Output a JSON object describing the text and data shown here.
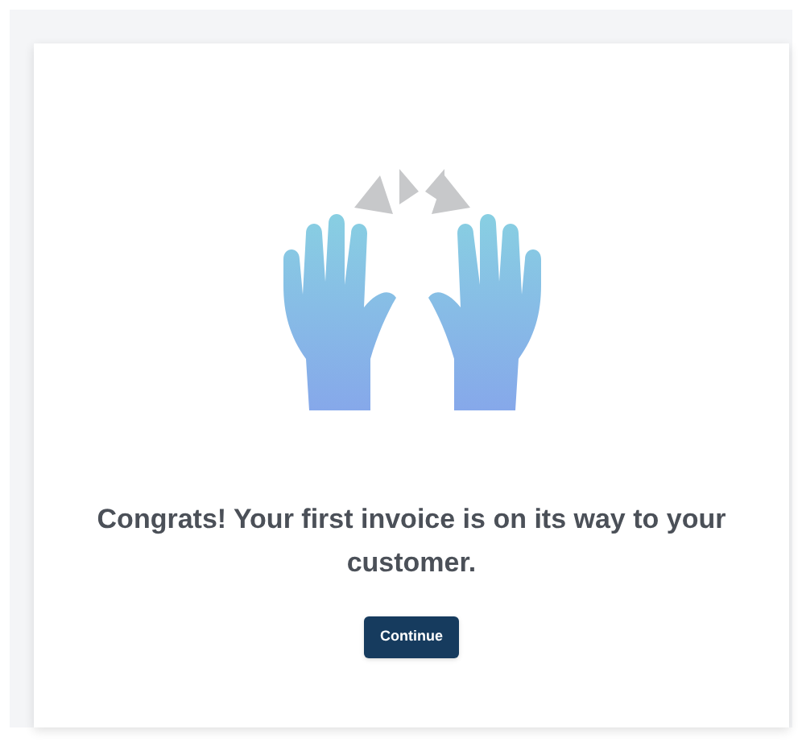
{
  "message": "Congrats! Your first invoice is on its way to your customer.",
  "button": {
    "label": "Continue"
  }
}
